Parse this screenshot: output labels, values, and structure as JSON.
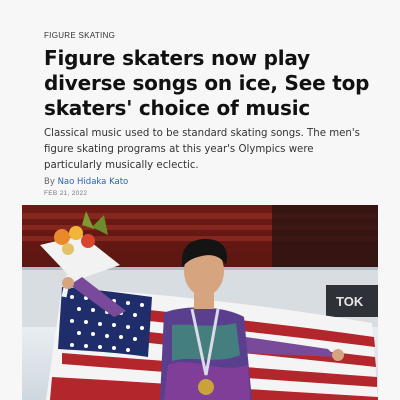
{
  "article": {
    "category": "FIGURE SKATING",
    "headline": "Figure skaters now play diverse songs on ice, See top skaters' choice of music",
    "dek": "Classical music used to be standard skating songs. The men's figure skating programs at this year's Olympics were particularly musically eclectic.",
    "byline_prefix": "By",
    "author": "Nao Hidaka Kato",
    "date": "FEB 21, 2022"
  },
  "photo": {
    "board_text": "TOK"
  },
  "colors": {
    "link": "#2b62b8",
    "flag_red": "#b3262c",
    "flag_blue": "#1f2e6b",
    "arena_red": "#7a1d17"
  }
}
